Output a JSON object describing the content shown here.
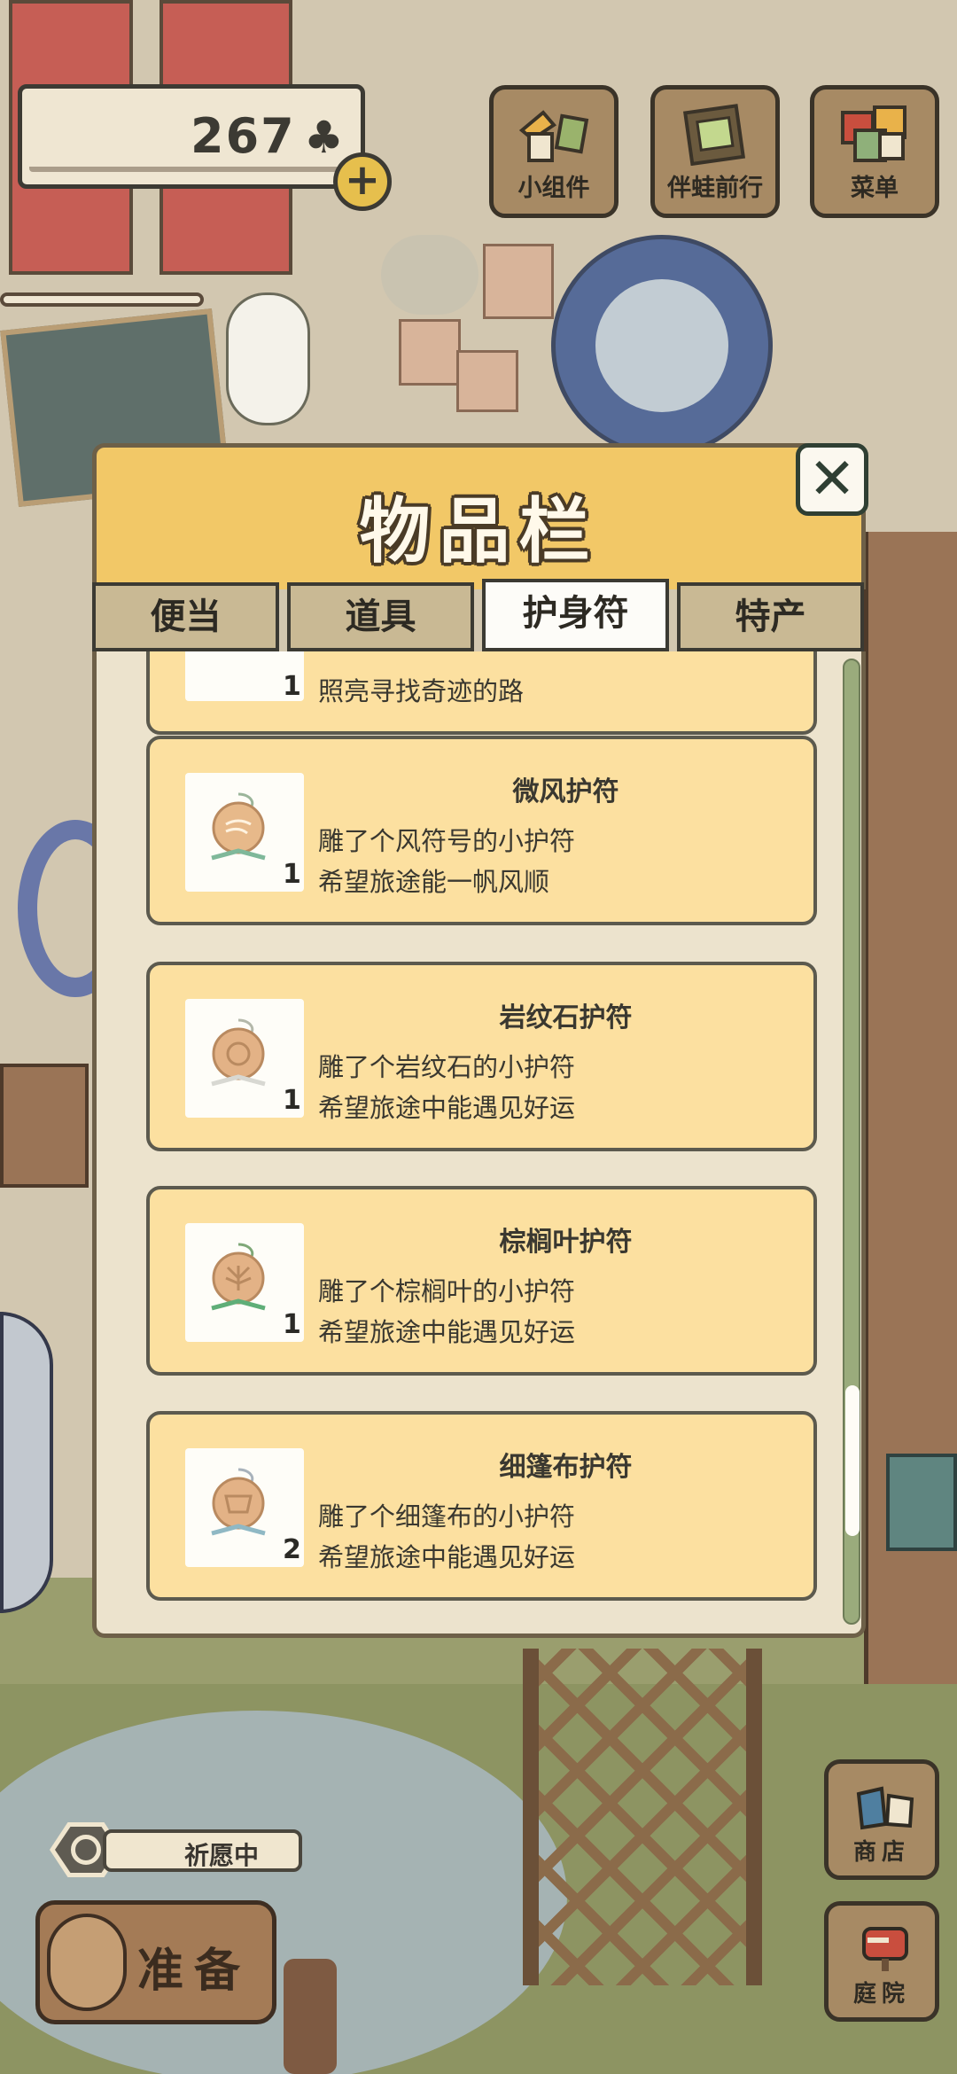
{
  "hud": {
    "clover_count": "267",
    "clover_icon": "clover-icon",
    "add_icon": "plus-icon",
    "buttons": [
      {
        "label": "小组件",
        "icon": "widget-icon"
      },
      {
        "label": "伴蛙前行",
        "icon": "album-icon"
      },
      {
        "label": "菜单",
        "icon": "menu-icon"
      }
    ]
  },
  "dialog": {
    "title": "物品栏",
    "close_icon": "close-icon",
    "tabs": [
      {
        "label": "便当",
        "active": false
      },
      {
        "label": "道具",
        "active": false
      },
      {
        "label": "护身符",
        "active": true
      },
      {
        "label": "特产",
        "active": false
      }
    ],
    "items": [
      {
        "name": "",
        "desc1": "",
        "desc2": "照亮寻找奇迹的路",
        "count": "1",
        "partial": true
      },
      {
        "name": "微风护符",
        "desc1": "雕了个风符号的小护符",
        "desc2": "希望旅途能一帆风顺",
        "count": "1"
      },
      {
        "name": "岩纹石护符",
        "desc1": "雕了个岩纹石的小护符",
        "desc2": "希望旅途中能遇见好运",
        "count": "1"
      },
      {
        "name": "棕榈叶护符",
        "desc1": "雕了个棕榈叶的小护符",
        "desc2": "希望旅途中能遇见好运",
        "count": "1"
      },
      {
        "name": "细篷布护符",
        "desc1": "雕了个细篷布的小护符",
        "desc2": "希望旅途中能遇见好运",
        "count": "2"
      }
    ]
  },
  "bottom": {
    "wish_label": "祈愿中",
    "prepare_label": "准备",
    "shop_label": "商店",
    "yard_label": "庭院"
  },
  "colors": {
    "header": "#f2c867",
    "card": "#fce0a0",
    "tab_active": "#fdfcf8",
    "tab_inactive": "#c9b994",
    "wood": "#a78a64"
  }
}
